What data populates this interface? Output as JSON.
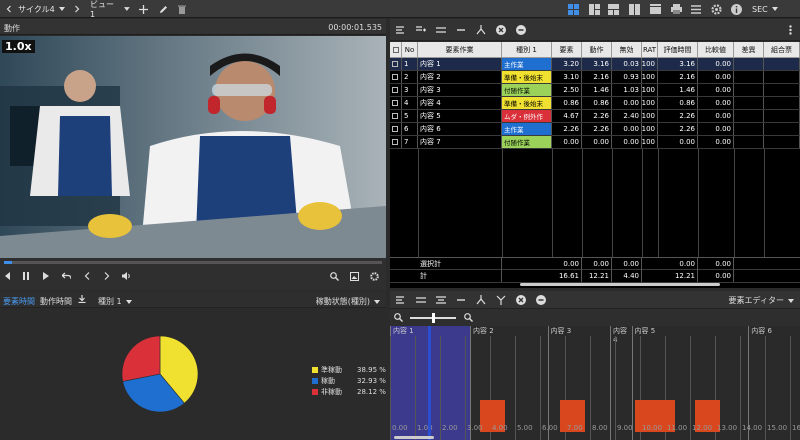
{
  "topbar": {
    "cycle_label": "サイクル4",
    "view_label": "ビュー 1",
    "unit_label": "SEC"
  },
  "video": {
    "title": "動作",
    "time": "00:00:01.535",
    "speed": "1.0x",
    "playback_progress": 0.02
  },
  "pie_panel": {
    "tabs": [
      "要素時間",
      "動作時間"
    ],
    "filter_label": "種別 1",
    "mode_label": "稼動状態(種別)",
    "legend": [
      {
        "label": "準稼動",
        "value": "38.95 %",
        "color": "#f0e030"
      },
      {
        "label": "稼動",
        "value": "32.93 %",
        "color": "#1f6fd0"
      },
      {
        "label": "非稼動",
        "value": "28.12 %",
        "color": "#d9303a"
      }
    ]
  },
  "table": {
    "headers": [
      "No",
      "要素作業",
      "種別 1",
      "要素",
      "動作",
      "無効",
      "RAT",
      "評価時間",
      "比較値",
      "差異",
      "組合票"
    ],
    "rows": [
      {
        "no": "1",
        "name": "内容 1",
        "type": "主作業",
        "type_color": "#1f6fd0",
        "type_text": "#ffffff",
        "elem": "3.20",
        "act": "3.16",
        "inv": "0.03",
        "rat": "100",
        "eval": "3.16",
        "cmp": "0.00",
        "selected": true
      },
      {
        "no": "2",
        "name": "内容 2",
        "type": "準備・後始末",
        "type_color": "#f0e030",
        "type_text": "#000000",
        "elem": "3.10",
        "act": "2.16",
        "inv": "0.93",
        "rat": "100",
        "eval": "2.16",
        "cmp": "0.00",
        "selected": false
      },
      {
        "no": "3",
        "name": "内容 3",
        "type": "付随作業",
        "type_color": "#9bd35a",
        "type_text": "#000000",
        "elem": "2.50",
        "act": "1.46",
        "inv": "1.03",
        "rat": "100",
        "eval": "1.46",
        "cmp": "0.00",
        "selected": false
      },
      {
        "no": "4",
        "name": "内容 4",
        "type": "準備・後始末",
        "type_color": "#f0e030",
        "type_text": "#000000",
        "elem": "0.86",
        "act": "0.86",
        "inv": "0.00",
        "rat": "100",
        "eval": "0.86",
        "cmp": "0.00",
        "selected": false
      },
      {
        "no": "5",
        "name": "内容 5",
        "type": "ムダ・例外作",
        "type_color": "#d9303a",
        "type_text": "#ffffff",
        "elem": "4.67",
        "act": "2.26",
        "inv": "2.40",
        "rat": "100",
        "eval": "2.26",
        "cmp": "0.00",
        "selected": false
      },
      {
        "no": "6",
        "name": "内容 6",
        "type": "主作業",
        "type_color": "#1f6fd0",
        "type_text": "#ffffff",
        "elem": "2.26",
        "act": "2.26",
        "inv": "0.00",
        "rat": "100",
        "eval": "2.26",
        "cmp": "0.00",
        "selected": false
      },
      {
        "no": "7",
        "name": "内容 7",
        "type": "付随作業",
        "type_color": "#9bd35a",
        "type_text": "#000000",
        "elem": "0.00",
        "act": "0.00",
        "inv": "0.00",
        "rat": "100",
        "eval": "0.00",
        "cmp": "0.00",
        "selected": false
      }
    ],
    "cumulative": {
      "label": "選択計",
      "elem": "0.00",
      "act": "0.00",
      "inv": "0.00",
      "eval": "0.00",
      "cmp": "0.00"
    },
    "total": {
      "label": "計",
      "elem": "16.61",
      "act": "12.21",
      "inv": "4.40",
      "eval": "12.21",
      "cmp": "0.00"
    }
  },
  "element_editor": {
    "label": "要素エディター",
    "zoom_level": 0.5
  },
  "timeline": {
    "segments": [
      {
        "label": "内容 1",
        "start": 0.0,
        "end": 3.2
      },
      {
        "label": "内容 2",
        "start": 3.2,
        "end": 6.3
      },
      {
        "label": "内容 3",
        "start": 6.3,
        "end": 8.8
      },
      {
        "label": "内容 4",
        "start": 8.8,
        "end": 9.66
      },
      {
        "label": "内容 5",
        "start": 9.66,
        "end": 14.33
      },
      {
        "label": "内容 6",
        "start": 14.33,
        "end": 16.61
      }
    ],
    "bars": [
      {
        "start": 3.6,
        "end": 4.6
      },
      {
        "start": 6.8,
        "end": 7.8
      },
      {
        "start": 9.8,
        "end": 11.4
      },
      {
        "start": 12.2,
        "end": 13.2
      }
    ],
    "ticks": [
      "0.00",
      "1.00",
      "2.00",
      "3.00",
      "4.00",
      "5.00",
      "6.00",
      "7.00",
      "8.00",
      "9.00",
      "10.00",
      "11.00",
      "12.00",
      "13.00",
      "14.00",
      "15.00",
      "16.00"
    ],
    "playhead": 1.535,
    "selected_segment": 0
  },
  "chart_data": {
    "type": "pie",
    "categories": [
      "準稼動",
      "稼動",
      "非稼動"
    ],
    "values": [
      38.95,
      32.93,
      28.12
    ],
    "colors": [
      "#f0e030",
      "#1f6fd0",
      "#d9303a"
    ],
    "legend_position": "right"
  }
}
